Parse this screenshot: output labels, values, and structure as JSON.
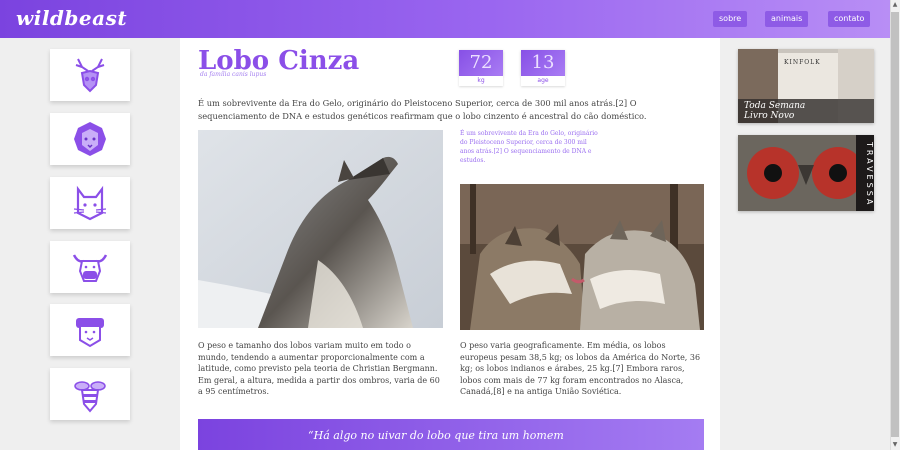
{
  "header": {
    "logo": "wildbeast",
    "nav": [
      {
        "label": "sobre"
      },
      {
        "label": "animais"
      },
      {
        "label": "contato"
      }
    ]
  },
  "sidebar": {
    "icons": [
      "deer-icon",
      "lion-icon",
      "cat-icon",
      "bull-icon",
      "sheep-icon",
      "bee-icon"
    ]
  },
  "article": {
    "title": "Lobo Cinza",
    "subtitle": "da família canis lupus",
    "stats": [
      {
        "value": "72",
        "unit": "kg"
      },
      {
        "value": "13",
        "unit": "age"
      }
    ],
    "intro": "É um sobrevivente da Era do Gelo, originário do Pleistoceno Superior, cerca de 300 mil anos atrás.[2] O sequenciamento de DNA e estudos genéticos reafirmam que o lobo cinzento é ancestral do cão doméstico.",
    "sidenote": "É um sobrevivente da Era do Gelo, originário do Pleistoceno Superior, cerca de 300 mil anos atrás.[2] O sequenciamento de DNA e estudos.",
    "para_left": "O peso e tamanho dos lobos variam muito em todo o mundo, tendendo a aumentar proporcionalmente com a latitude, como previsto pela teoria de Christian Bergmann. Em geral, a altura, medida a partir dos ombros, varia de 60 a 95 centímetros.",
    "para_right": "O peso varia geograficamente. Em média, os lobos europeus pesam 38,5 kg; os lobos da América do Norte, 36 kg; os lobos indianos e árabes, 25 kg.[7] Embora raros, lobos com mais de 77 kg foram encontrados no Alasca, Canadá,[8] e na antiga União Soviética.",
    "quote": "“Há algo no uivar do lobo que tira um homem"
  },
  "ads": {
    "ad1_brand": "KINFOLK",
    "ad1_caption_line1": "Toda Semana",
    "ad1_caption_line2": "Livro Novo",
    "ad2_label": "TRAVESSA"
  },
  "colors": {
    "accent": "#8b4fe8",
    "header_start": "#7b43df",
    "header_end": "#b88ef5"
  }
}
